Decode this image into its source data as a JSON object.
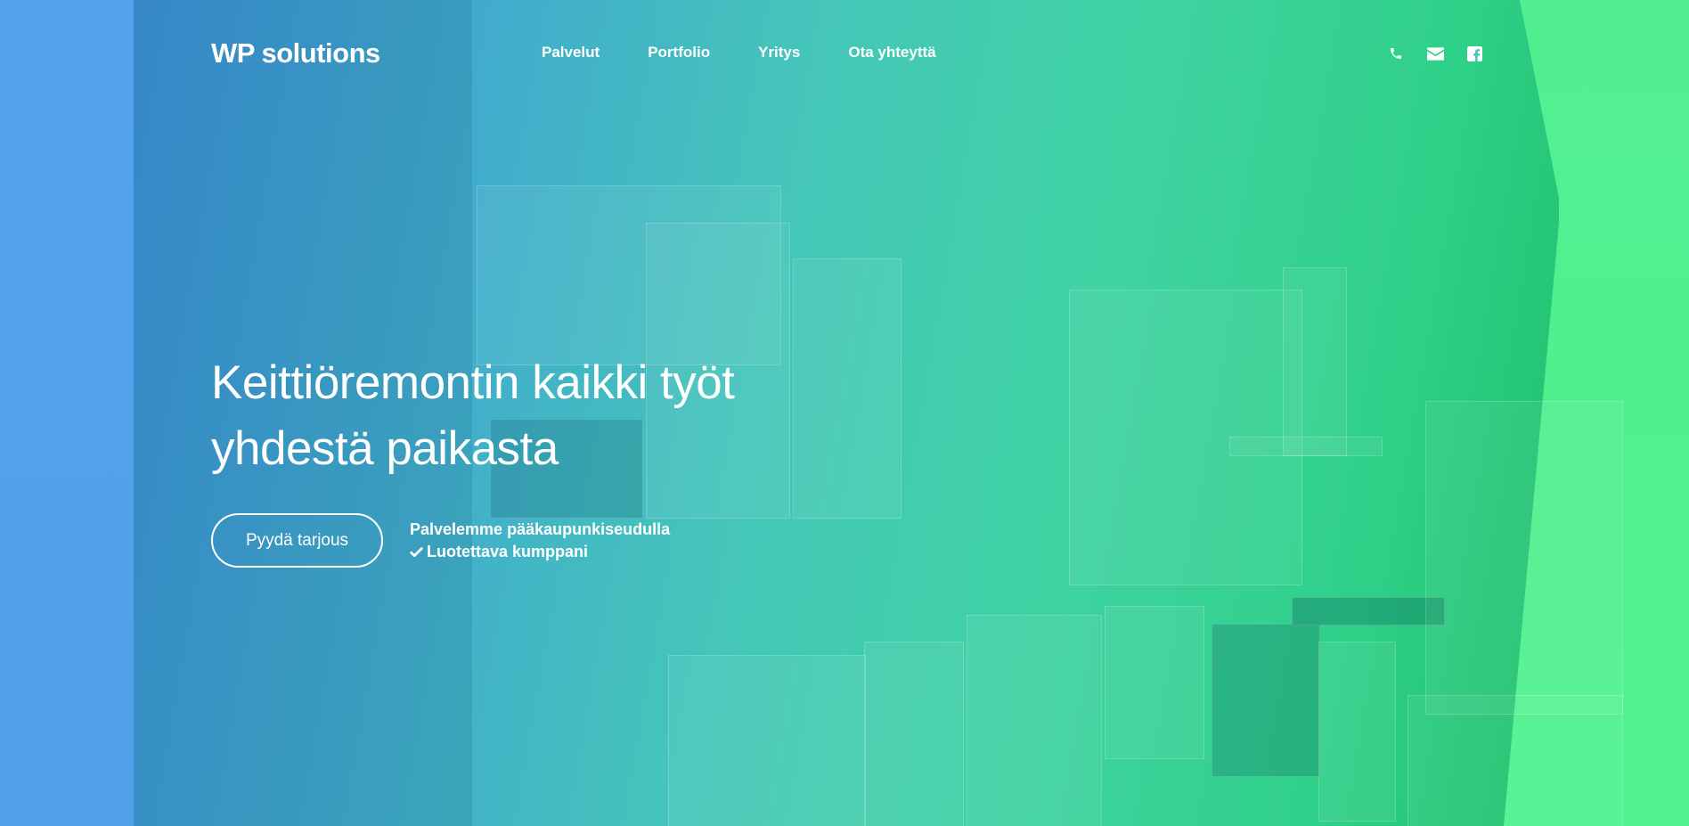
{
  "brand": {
    "logo": "WP solutions"
  },
  "nav": {
    "items": [
      {
        "label": "Palvelut"
      },
      {
        "label": "Portfolio"
      },
      {
        "label": "Yritys"
      },
      {
        "label": "Ota yhteyttä"
      }
    ]
  },
  "social": {
    "icons": [
      "phone-icon",
      "envelope-icon",
      "facebook-icon"
    ]
  },
  "hero": {
    "headline_line1": "Keittiöremontin kaikki työt",
    "headline_line2": "yhdestä paikasta",
    "cta_label": "Pyydä tarjous",
    "info_line1": "Palvelemme pääkaupunkiseudulla",
    "info_line2": "Luotettava kumppani"
  },
  "colors": {
    "gradient_start": "#52a0ec",
    "gradient_end": "#4ef28e",
    "text": "#ffffff"
  }
}
